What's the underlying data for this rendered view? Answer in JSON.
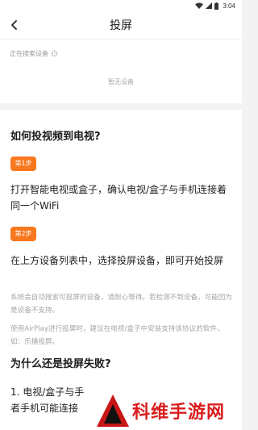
{
  "status_bar": {
    "time": "3:04"
  },
  "header": {
    "title": "投屏"
  },
  "search": {
    "searching_text": "正在搜索设备",
    "empty_text": "暂无设备"
  },
  "help": {
    "heading": "如何投视频到电视?",
    "steps": [
      {
        "badge": "第1步",
        "text": "打开智能电视或盒子，确认电视/盒子与手机连接着同一个WiFi"
      },
      {
        "badge": "第2步",
        "text": "在上方设备列表中，选择投屏设备，即可开始投屏"
      }
    ],
    "notes": [
      "系统会自动搜索可投屏的设备，请耐心等待。若检测不到设备，可能因为是设备不支持。",
      "使用AirPlay进行投屏时，建议在电视/盒子中安装支持该协议的软件，如：乐播投屏。"
    ]
  },
  "failure": {
    "heading": "为什么还是投屏失败?",
    "item1": "1. 电视/盒子与手",
    "item1_cont": "者手机可能连接"
  },
  "watermark": {
    "text": "科维手游网"
  },
  "colors": {
    "accent": "#f7781e",
    "watermark": "#d91d1d"
  }
}
